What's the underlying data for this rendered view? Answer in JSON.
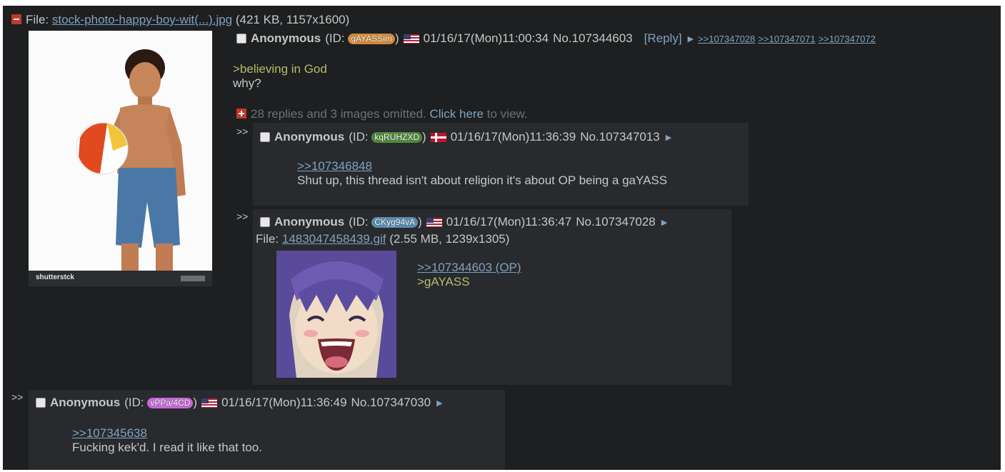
{
  "thread": {
    "op": {
      "file_label": "File:",
      "file_name": "stock-photo-happy-boy-wit(...).jpg",
      "file_meta": "(421 KB, 1157x1600)",
      "image_caption": "shutterstck",
      "name": "Anonymous",
      "id_prefix": "(ID:",
      "id": "gAYASSim",
      "id_suffix": ")",
      "id_color": "#d08a3a",
      "datetime": "01/16/17(Mon)11:00:34",
      "post_no": "No.107344603",
      "reply_label": "[Reply]",
      "backlinks": [
        ">>107347028",
        ">>107347071",
        ">>107347072"
      ],
      "lines": [
        ">believing in God",
        "why?"
      ]
    },
    "omitted": {
      "text": "28 replies and 3 images omitted.",
      "link": "Click here",
      "suffix": "to view."
    },
    "replies": [
      {
        "gt": ">>",
        "name": "Anonymous",
        "id_prefix": "(ID:",
        "id": "kqRUHZXD",
        "id_suffix": ")",
        "id_color": "#4e8a3a",
        "flag": "dk",
        "datetime": "01/16/17(Mon)11:36:39",
        "post_no": "No.107347013",
        "quote_link": ">>107346848",
        "text": "Shut up, this thread isn't about religion it's about OP being a gaYASS"
      },
      {
        "gt": ">>",
        "name": "Anonymous",
        "id_prefix": "(ID:",
        "id": "CKyg94vA",
        "id_suffix": ")",
        "id_color": "#5a8cb0",
        "flag": "us",
        "datetime": "01/16/17(Mon)11:36:47",
        "post_no": "No.107347028",
        "file_label": "File:",
        "file_name": "1483047458439.gif",
        "file_meta": "(2.55 MB, 1239x1305)",
        "quote_link": ">>107344603 (OP)",
        "greentext": ">gAYASS"
      },
      {
        "gt": ">>",
        "name": "Anonymous",
        "id_prefix": "(ID:",
        "id": "vPPa/4CD",
        "id_suffix": ")",
        "id_color": "#c569d6",
        "flag": "us",
        "datetime": "01/16/17(Mon)11:36:49",
        "post_no": "No.107347030",
        "quote_link": ">>107345638",
        "text": "Fucking kek'd. I read it like that too."
      }
    ]
  }
}
